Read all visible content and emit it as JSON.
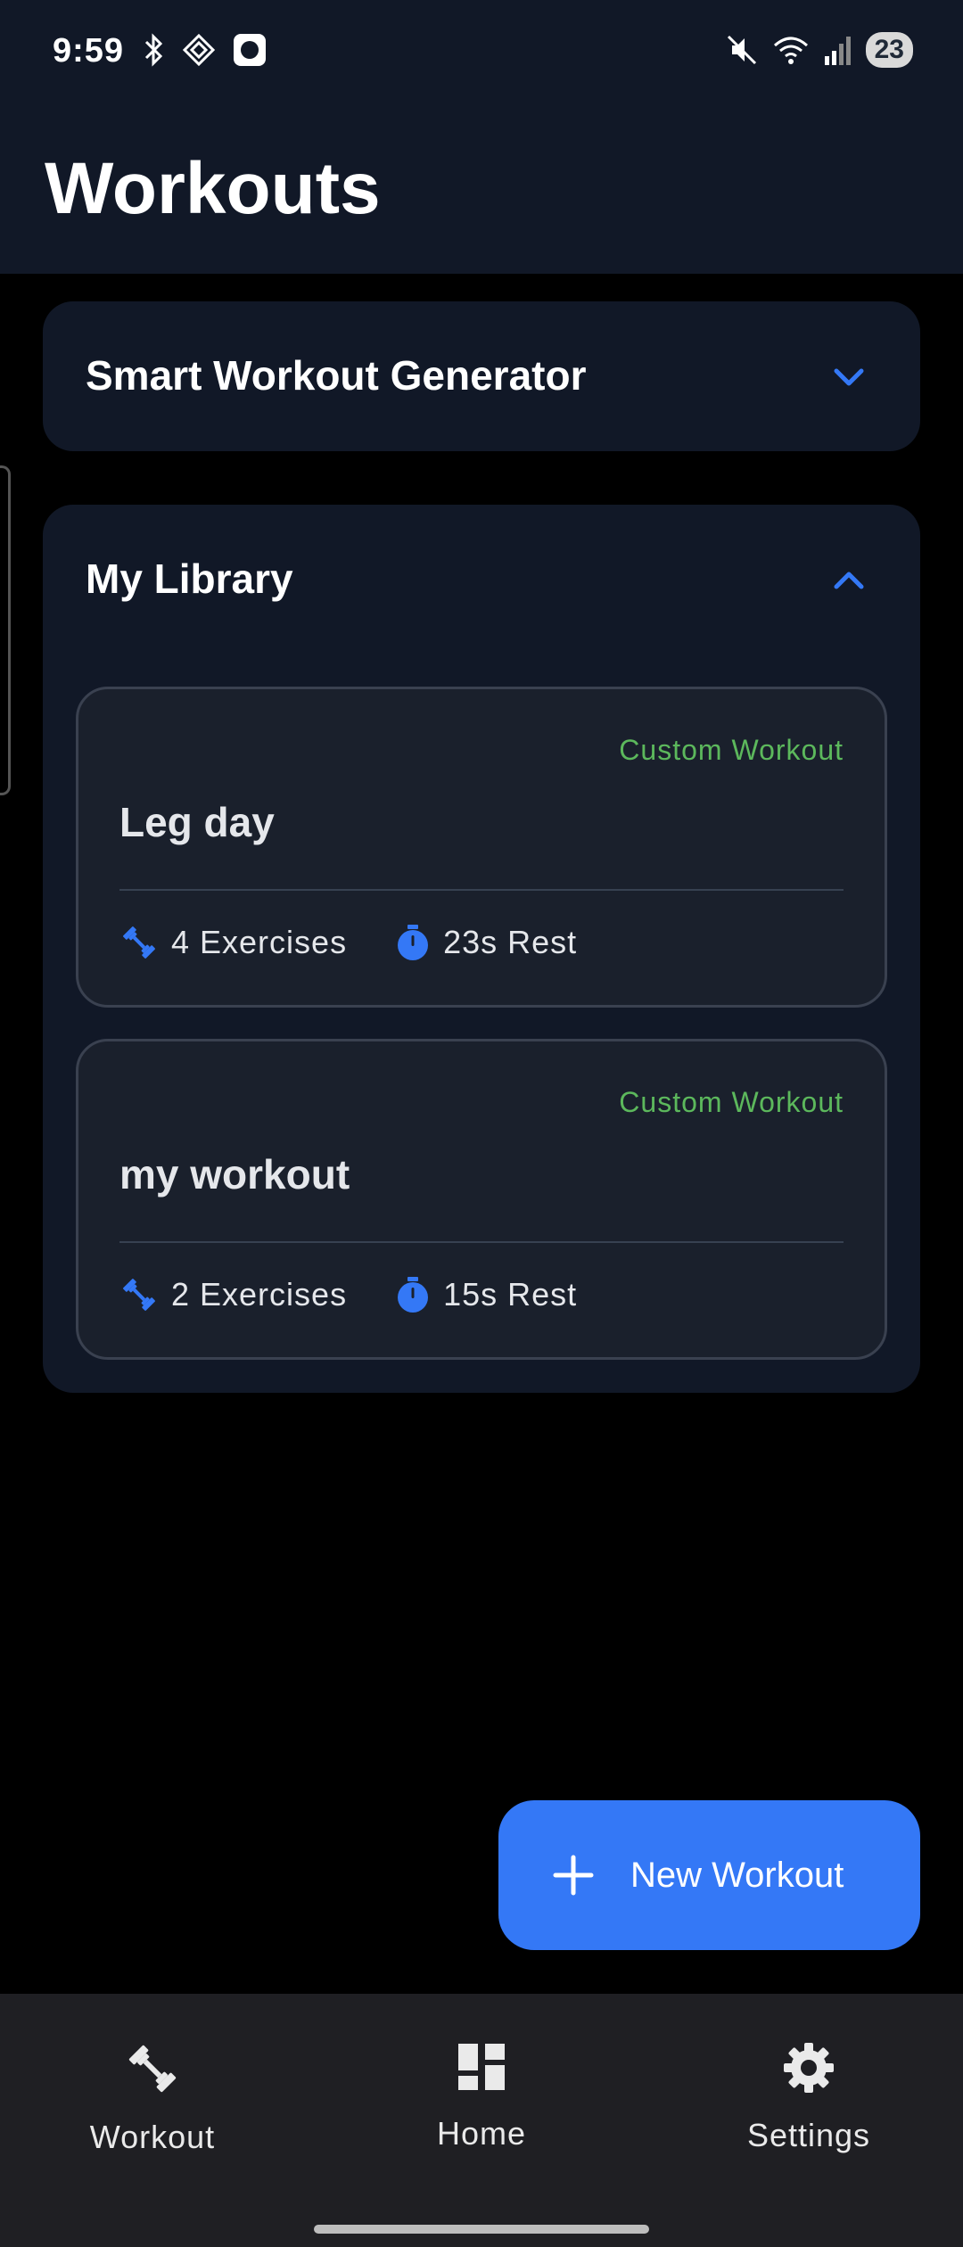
{
  "status_bar": {
    "time": "9:59",
    "battery": "23",
    "icons_left": [
      "bluetooth-icon",
      "nfc-icon",
      "app-icon"
    ],
    "icons_right": [
      "mute-icon",
      "wifi-icon",
      "signal-icon"
    ]
  },
  "header": {
    "title": "Workouts"
  },
  "generator": {
    "title": "Smart Workout Generator",
    "expanded": false
  },
  "library": {
    "title": "My Library",
    "expanded": true,
    "workouts": [
      {
        "tag": "Custom Workout",
        "name": "Leg day",
        "exercises": "4 Exercises",
        "rest": "23s Rest"
      },
      {
        "tag": "Custom Workout",
        "name": "my workout",
        "exercises": "2 Exercises",
        "rest": "15s Rest"
      }
    ]
  },
  "fab": {
    "label": "New Workout"
  },
  "bottom_nav": {
    "items": [
      {
        "label": "Workout",
        "icon": "dumbbell-icon"
      },
      {
        "label": "Home",
        "icon": "dashboard-icon"
      },
      {
        "label": "Settings",
        "icon": "gear-icon"
      }
    ]
  },
  "colors": {
    "accent": "#3478f6",
    "tag_green": "#5cb85c",
    "card_bg": "#111827",
    "workout_card_bg": "#1a202c"
  }
}
